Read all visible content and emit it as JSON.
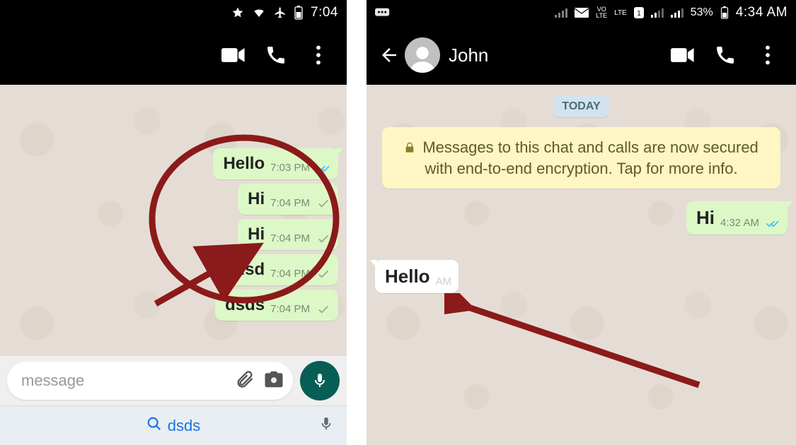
{
  "left": {
    "status": {
      "time": "7:04"
    },
    "messages": [
      {
        "text": "Hello",
        "time": "7:03 PM",
        "status": "read"
      },
      {
        "text": "Hi",
        "time": "7:04 PM",
        "status": "sent"
      },
      {
        "text": "Hi",
        "time": "7:04 PM",
        "status": "sent"
      },
      {
        "text": "sdsd",
        "time": "7:04 PM",
        "status": "sent"
      },
      {
        "text": "dsds",
        "time": "7:04 PM",
        "status": "sent"
      }
    ],
    "input": {
      "placeholder": "message"
    },
    "keyboard": {
      "suggestion": "dsds"
    }
  },
  "right": {
    "status": {
      "battery": "53%",
      "time": "4:34 AM"
    },
    "contact": {
      "name": "John"
    },
    "date_chip": "TODAY",
    "encryption_notice": "Messages to this chat and calls are now secured with end-to-end encryption. Tap for more info.",
    "messages": [
      {
        "dir": "out",
        "text": "Hi",
        "time": "4:32 AM",
        "status": "read"
      },
      {
        "dir": "in",
        "text": "Hello",
        "time": "AM"
      }
    ]
  },
  "colors": {
    "annotation": "#8b1a1a"
  }
}
